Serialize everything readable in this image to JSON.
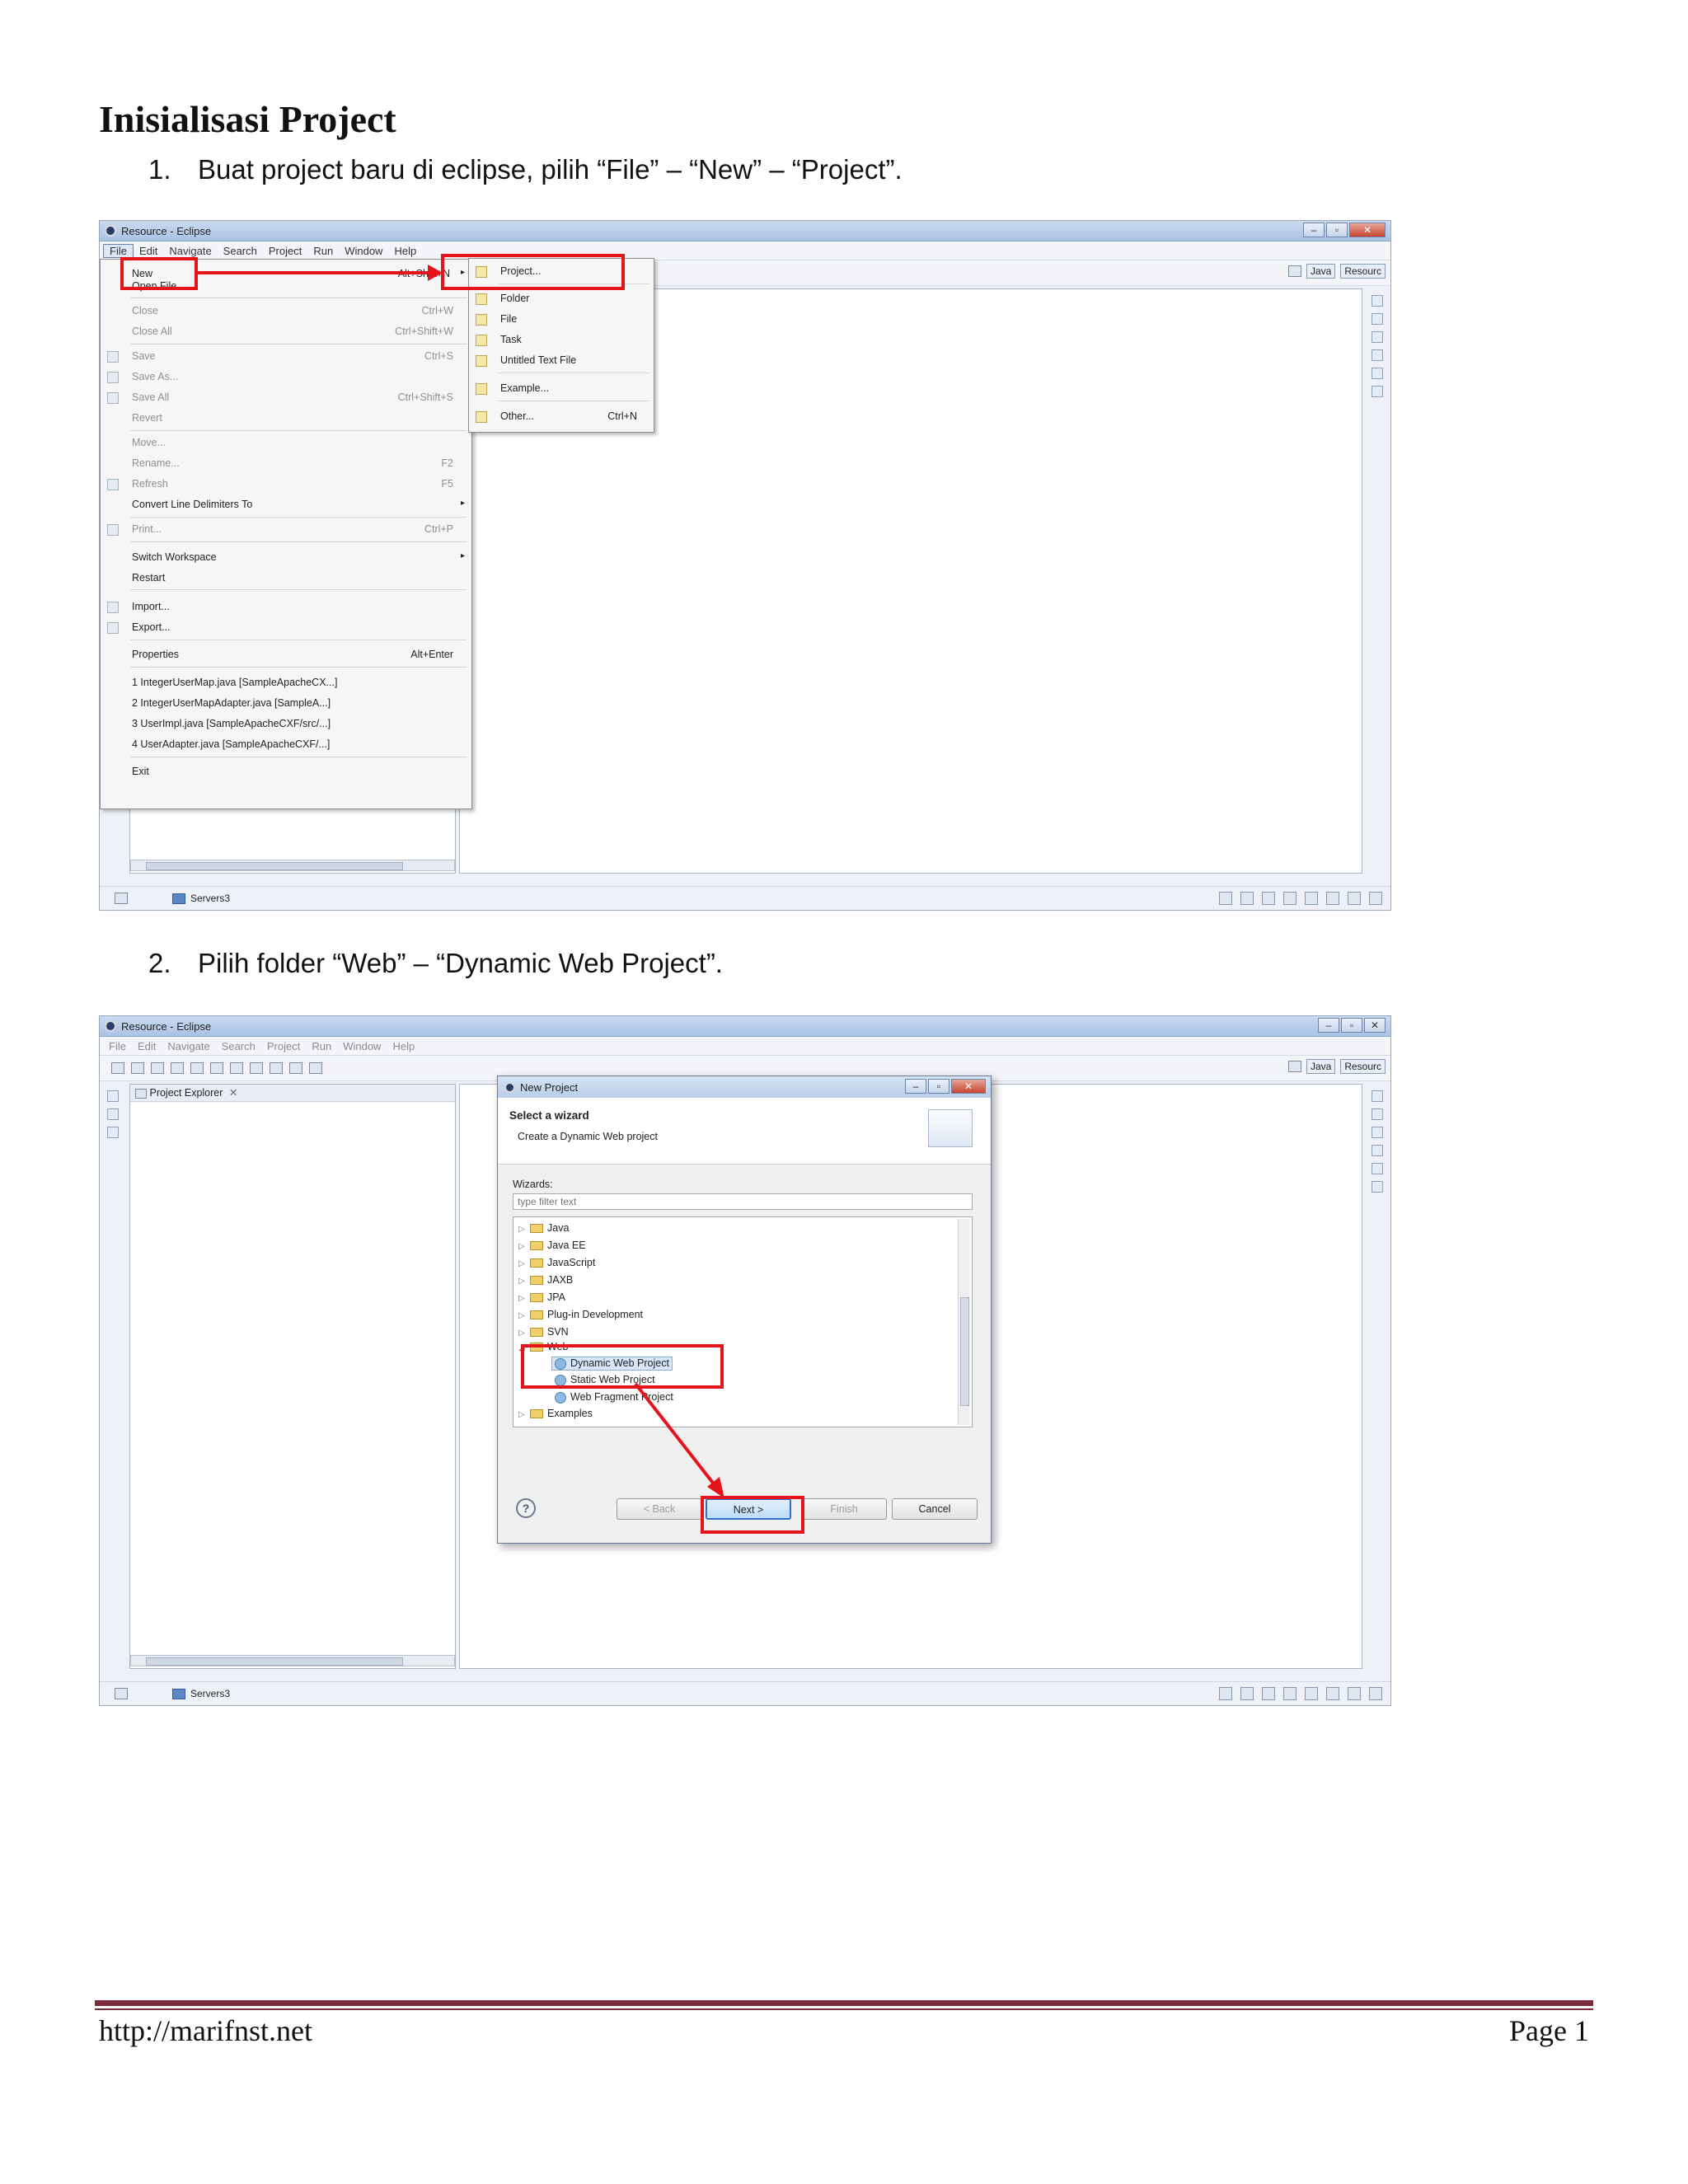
{
  "doc": {
    "title": "Inisialisasi Project",
    "step1": {
      "num": "1.",
      "text": "Buat project baru di eclipse, pilih “File” – “New” – “Project”."
    },
    "step2": {
      "num": "2.",
      "text": "Pilih folder “Web” – “Dynamic Web Project”."
    },
    "footer": {
      "url": "http://marifnst.net",
      "page": "Page 1"
    }
  },
  "shot1": {
    "window_title": "Resource - Eclipse",
    "menu": [
      "File",
      "Edit",
      "Navigate",
      "Search",
      "Project",
      "Run",
      "Window",
      "Help"
    ],
    "perspective_java": "Java",
    "perspective_resource": "Resourc",
    "file_menu": {
      "new": "New",
      "new_sc": "Alt+Shift+N",
      "open_file": "Open File...",
      "close": "Close",
      "close_sc": "Ctrl+W",
      "close_all": "Close All",
      "close_all_sc": "Ctrl+Shift+W",
      "save": "Save",
      "save_sc": "Ctrl+S",
      "save_as": "Save As...",
      "save_all": "Save All",
      "save_all_sc": "Ctrl+Shift+S",
      "revert": "Revert",
      "move": "Move...",
      "rename": "Rename...",
      "rename_sc": "F2",
      "refresh": "Refresh",
      "refresh_sc": "F5",
      "convert": "Convert Line Delimiters To",
      "print": "Print...",
      "print_sc": "Ctrl+P",
      "switch_ws": "Switch Workspace",
      "restart": "Restart",
      "import": "Import...",
      "export": "Export...",
      "properties": "Properties",
      "properties_sc": "Alt+Enter",
      "recent1": "1 IntegerUserMap.java  [SampleApacheCX...]",
      "recent2": "2 IntegerUserMapAdapter.java  [SampleA...]",
      "recent3": "3 UserImpl.java  [SampleApacheCXF/src/...]",
      "recent4": "4 UserAdapter.java  [SampleApacheCXF/...]",
      "exit": "Exit"
    },
    "new_submenu": {
      "project": "Project...",
      "folder": "Folder",
      "file": "File",
      "task": "Task",
      "untitled": "Untitled Text File",
      "example": "Example...",
      "other": "Other...",
      "other_sc": "Ctrl+N"
    },
    "status_servers": "Servers3"
  },
  "shot2": {
    "window_title": "Resource - Eclipse",
    "menu": [
      "File",
      "Edit",
      "Navigate",
      "Search",
      "Project",
      "Run",
      "Window",
      "Help"
    ],
    "perspective_java": "Java",
    "perspective_resource": "Resourc",
    "project_explorer": "Project Explorer",
    "dialog": {
      "title": "New Project",
      "heading": "Select a wizard",
      "subheading": "Create a Dynamic Web project",
      "wizards_label": "Wizards:",
      "filter_placeholder": "type filter text",
      "tree": [
        "Java",
        "Java EE",
        "JavaScript",
        "JAXB",
        "JPA",
        "Plug-in Development",
        "SVN",
        "Web"
      ],
      "web_children": [
        "Dynamic Web Project",
        "Static Web Project",
        "Web Fragment Project"
      ],
      "examples": "Examples",
      "back": "< Back",
      "next": "Next >",
      "finish": "Finish",
      "cancel": "Cancel",
      "help": "?"
    },
    "status_servers": "Servers3"
  }
}
